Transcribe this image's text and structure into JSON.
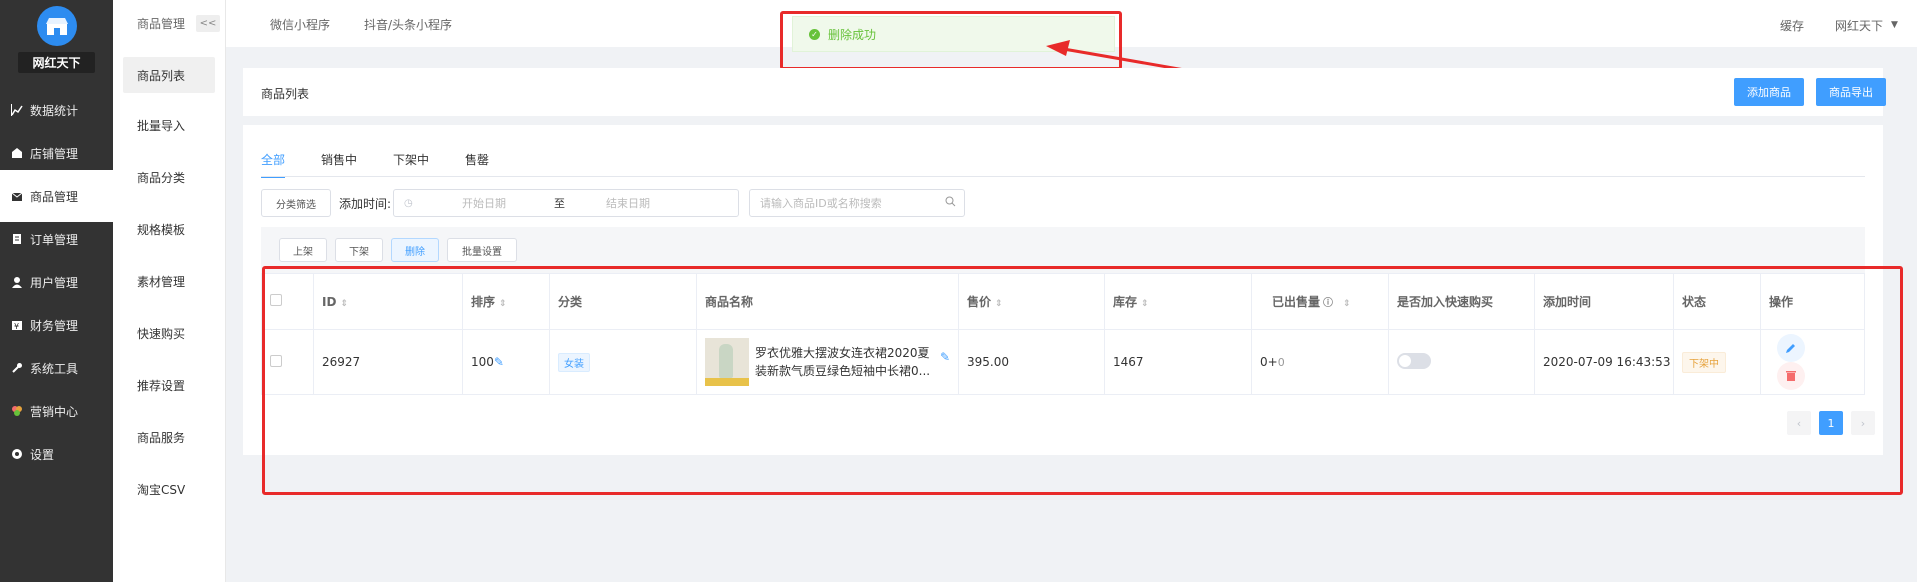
{
  "sidebar": {
    "shop_name": "网红天下",
    "items": [
      {
        "label": "数据统计",
        "icon": "chart-icon"
      },
      {
        "label": "店铺管理",
        "icon": "store-icon"
      },
      {
        "label": "商品管理",
        "icon": "goods-icon"
      },
      {
        "label": "订单管理",
        "icon": "order-icon"
      },
      {
        "label": "用户管理",
        "icon": "user-icon"
      },
      {
        "label": "财务管理",
        "icon": "finance-icon"
      },
      {
        "label": "系统工具",
        "icon": "wrench-icon"
      },
      {
        "label": "营销中心",
        "icon": "marketing-icon"
      },
      {
        "label": "设置",
        "icon": "gear-icon"
      }
    ]
  },
  "subnav": {
    "title": "商品管理",
    "collapse": "<<",
    "items": [
      "商品列表",
      "批量导入",
      "商品分类",
      "规格模板",
      "素材管理",
      "快速购买",
      "推荐设置",
      "商品服务",
      "淘宝CSV"
    ]
  },
  "topbar": {
    "tabs": [
      "微信小程序",
      "抖音/头条小程序"
    ],
    "cache": "缓存",
    "user": "网红天下"
  },
  "toast": {
    "message": "删除成功"
  },
  "header": {
    "title": "商品列表",
    "add_button": "添加商品",
    "export_button": "商品导出"
  },
  "tabs": [
    "全部",
    "销售中",
    "下架中",
    "售罄"
  ],
  "filter": {
    "category_button": "分类筛选",
    "date_label": "添加时间:",
    "start_placeholder": "开始日期",
    "separator": "至",
    "end_placeholder": "结束日期",
    "search_placeholder": "请输入商品ID或名称搜索"
  },
  "actions": [
    "上架",
    "下架",
    "删除",
    "批量设置"
  ],
  "table": {
    "headers": [
      "ID",
      "排序",
      "分类",
      "商品名称",
      "售价",
      "库存",
      "已出售量",
      "是否加入快速购买",
      "添加时间",
      "状态",
      "操作"
    ],
    "rows": [
      {
        "id": "26927",
        "sort": "100",
        "category": "女装",
        "name": "罗衣优雅大摆波女连衣裙2020夏装新款气质豆绿色短袖中长裙0...",
        "price": "395.00",
        "stock": "1467",
        "sold": "0+",
        "sold_extra": "0",
        "added": "2020-07-09 16:43:53",
        "status": "下架中"
      }
    ]
  },
  "pagination": {
    "prev": "‹",
    "current": "1",
    "next": "›"
  },
  "colors": {
    "primary": "#409eff",
    "success": "#67c23a",
    "danger": "#f56c6c",
    "annotation": "#e82a2a"
  }
}
